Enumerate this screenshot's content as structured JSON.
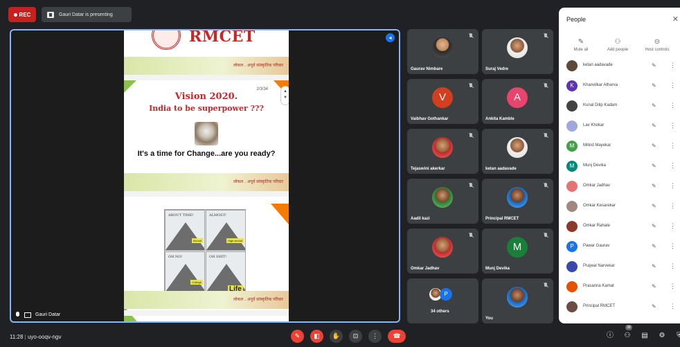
{
  "top": {
    "rec_label": "REC",
    "presenting_text": "Gauri Datar is presenting"
  },
  "presentation": {
    "presenter_name": "Gauri Datar",
    "logo_text": "RMCET",
    "band_text": "लोकल . अपूर्व सांस्कृतिक परिवार",
    "slide_number": "2/3/34",
    "vision_text": "Vision 2020.",
    "india_text": "India to be superpower ???",
    "change_text": "It's a time for Change...are you ready?",
    "cartoon_captions": [
      "ABOUT TIME!",
      "ALMOST!",
      "OH NO!",
      "OH SHIT!"
    ],
    "cartoon_labels": [
      "School",
      "High school",
      "College"
    ],
    "life_label": "Life"
  },
  "tiles": [
    {
      "name": "Gaurav Nimbare"
    },
    {
      "name": "Suraj Vedre"
    },
    {
      "name": "Vaibhav Gothankar",
      "initial": "V"
    },
    {
      "name": "Ankita Kamble",
      "initial": "A"
    },
    {
      "name": "Tejaswini akerkar"
    },
    {
      "name": "ketan aadavade"
    },
    {
      "name": "Aadil kazi"
    },
    {
      "name": "Principal RMCET"
    },
    {
      "name": "Omkar Jadhav"
    },
    {
      "name": "Munj Devika",
      "initial": "M"
    },
    {
      "name": "34 others",
      "initial": "P"
    },
    {
      "name": "You"
    }
  ],
  "people_panel": {
    "title": "People",
    "actions": [
      "Mute all",
      "Add people",
      "Host controls"
    ],
    "list": [
      {
        "name": "ketan aadavade",
        "initial": ""
      },
      {
        "name": "Khanvilkar Atharva",
        "initial": "K"
      },
      {
        "name": "Kunal Dilip Kadam",
        "initial": ""
      },
      {
        "name": "Lav Khokar",
        "initial": ""
      },
      {
        "name": "Milind Mayekar",
        "initial": "M"
      },
      {
        "name": "Munj Devika",
        "initial": "M"
      },
      {
        "name": "Omkar Jadhav",
        "initial": ""
      },
      {
        "name": "Omkar Kesarekar",
        "initial": ""
      },
      {
        "name": "Omkar Rahate",
        "initial": ""
      },
      {
        "name": "Pawar Gaurav",
        "initial": "P"
      },
      {
        "name": "Prajwal Narvekar",
        "initial": ""
      },
      {
        "name": "Prasanna Kamat",
        "initial": ""
      },
      {
        "name": "Principal RMCET",
        "initial": ""
      }
    ]
  },
  "bottom": {
    "time": "11:28",
    "meeting_code": "uyo-ooqv-ngv",
    "participants_badge": "38"
  },
  "colors": {
    "background": "#202124",
    "tile": "#3c4043",
    "accent_blue": "#8ab4f8",
    "rec_red": "#c5221f",
    "hangup_red": "#ea4335"
  },
  "icons": [
    "mic-off-icon",
    "present-icon",
    "close-icon",
    "add-person-icon",
    "host-controls-icon",
    "info-icon",
    "people-icon",
    "chat-icon",
    "activities-icon",
    "lock-icon",
    "hand-icon",
    "more-icon",
    "hangup-icon"
  ]
}
